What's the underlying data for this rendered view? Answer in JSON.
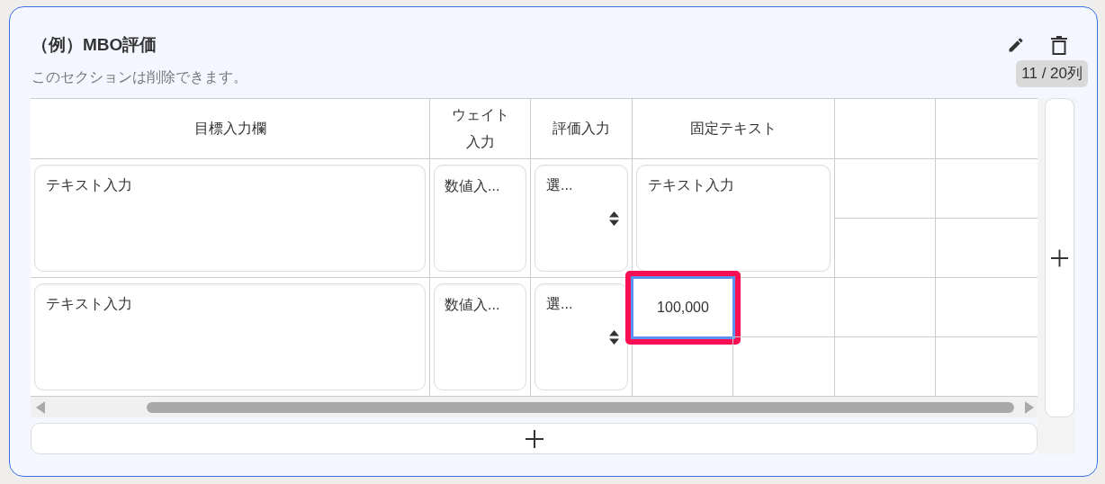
{
  "section": {
    "title": "（例）MBO評価",
    "description": "このセクションは削除できます。",
    "column_count": "11 / 20列"
  },
  "table": {
    "columns": [
      {
        "label": "目標入力欄"
      },
      {
        "label": "ウェイト入力"
      },
      {
        "label": "評価入力"
      },
      {
        "label": "固定テキスト"
      }
    ],
    "rows": [
      {
        "cells": [
          {
            "kind": "textarea",
            "placeholder": "テキスト入力"
          },
          {
            "kind": "number",
            "placeholder": "数値入..."
          },
          {
            "kind": "select",
            "value": "選..."
          },
          {
            "kind": "textarea",
            "placeholder": "テキスト入力"
          }
        ]
      },
      {
        "cells": [
          {
            "kind": "textarea",
            "placeholder": "テキスト入力"
          },
          {
            "kind": "number",
            "placeholder": "数値入..."
          },
          {
            "kind": "select",
            "value": "選..."
          },
          {
            "kind": "fixed",
            "text": "100,000",
            "highlighted": true
          }
        ]
      }
    ]
  }
}
